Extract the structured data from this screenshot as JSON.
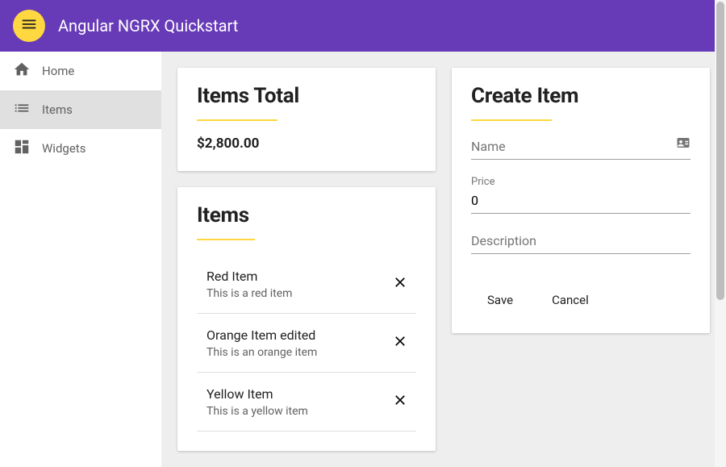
{
  "header": {
    "title": "Angular NGRX Quickstart"
  },
  "sidebar": {
    "items": [
      {
        "label": "Home",
        "icon": "home",
        "active": false
      },
      {
        "label": "Items",
        "icon": "list",
        "active": true
      },
      {
        "label": "Widgets",
        "icon": "widgets",
        "active": false
      }
    ]
  },
  "total_card": {
    "title": "Items Total",
    "value": "$2,800.00"
  },
  "items_card": {
    "title": "Items",
    "items": [
      {
        "name": "Red Item",
        "description": "This is a red item"
      },
      {
        "name": "Orange Item edited",
        "description": "This is an orange item"
      },
      {
        "name": "Yellow Item",
        "description": "This is a yellow item"
      }
    ]
  },
  "form_card": {
    "title": "Create Item",
    "name_label": "Name",
    "name_value": "",
    "price_label": "Price",
    "price_value": "0",
    "description_label": "Description",
    "description_value": "",
    "save_label": "Save",
    "cancel_label": "Cancel"
  }
}
